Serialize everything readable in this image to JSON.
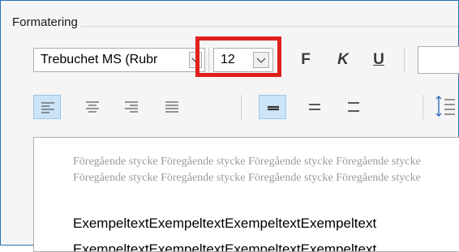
{
  "group": {
    "title": "Formatering"
  },
  "font": {
    "name": "Trebuchet MS (Rubr"
  },
  "size": {
    "value": "12"
  },
  "format_buttons": {
    "bold": "F",
    "italic": "K",
    "underline": "U"
  },
  "preview": {
    "previous_line_1": "Föregående stycke Föregående stycke Föregående stycke Föregående stycke",
    "previous_line_2": "Föregående stycke Föregående stycke Föregående stycke Föregående stycke",
    "sample_line_1": "ExempeltextExempeltextExempeltextExempeltext",
    "sample_line_2": "ExempeltextExempeltextExempeltextExempeltext"
  },
  "colors": {
    "highlight": "#e0201c",
    "active": "#cce4f7"
  }
}
